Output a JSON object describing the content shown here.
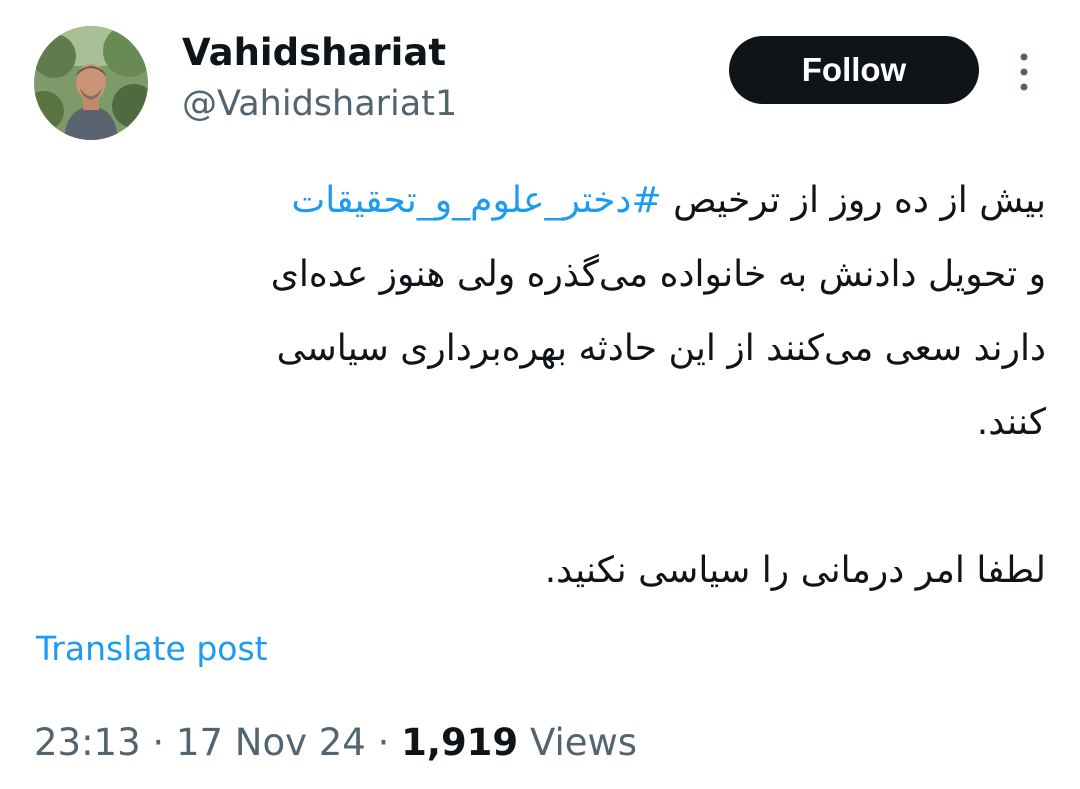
{
  "author": {
    "display_name": "Vahidshariat",
    "handle": "@Vahidshariat1"
  },
  "follow_label": "Follow",
  "more_icon": "more-vertical-icon",
  "tweet": {
    "line1_text": "بیش از ده روز از ترخیص ",
    "line1_hashtag": "#دختر_علوم_و_تحقیقات",
    "line2": "و تحویل دادنش به خانواده می‌گذره ولی هنوز عده‌ای",
    "line3": "دارند سعی می‌کنند از این حادثه بهره‌برداری سیاسی",
    "line4": "کنند.",
    "line5": "لطفا امر درمانی را سیاسی نکنید."
  },
  "translate_label": "Translate post",
  "meta": {
    "time": "23:13",
    "separator": "·",
    "date": "17 Nov 24",
    "views_count": "1,919",
    "views_label": "Views"
  },
  "colors": {
    "text": "#0f1419",
    "secondary": "#536471",
    "link": "#1d9bf0",
    "button_bg": "#0f1419"
  }
}
